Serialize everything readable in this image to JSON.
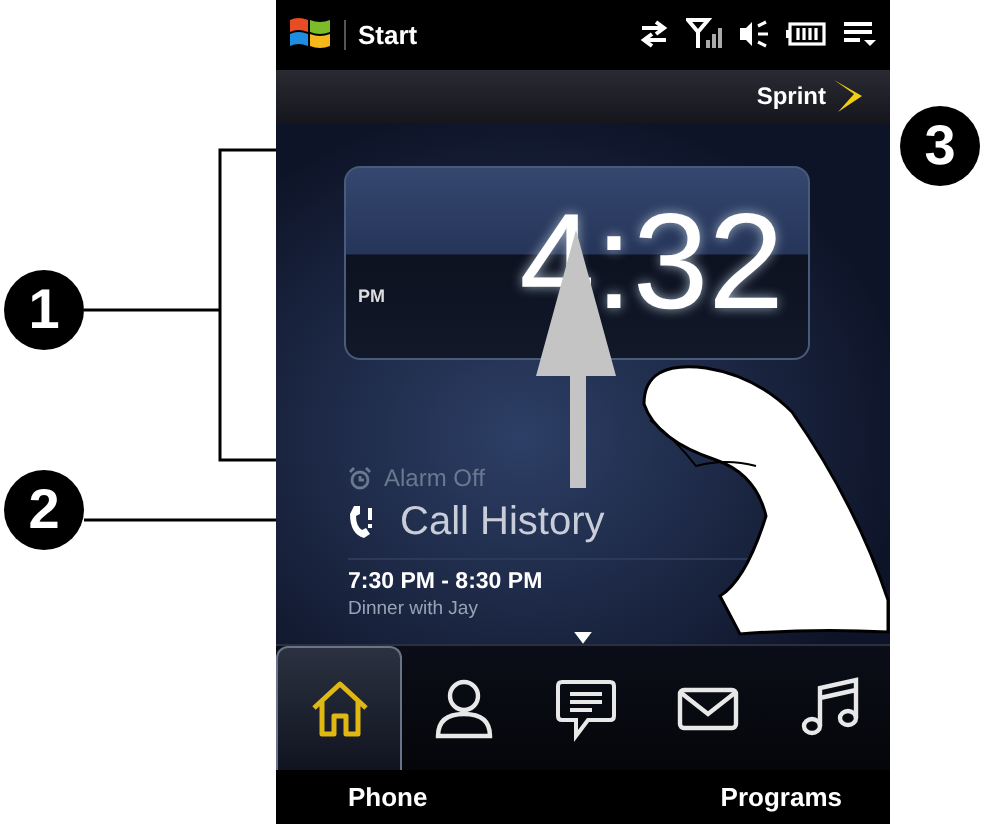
{
  "callouts": [
    {
      "number": "1"
    },
    {
      "number": "2"
    },
    {
      "number": "3"
    }
  ],
  "status_bar": {
    "title": "Start"
  },
  "carrier": "Sprint",
  "clock": {
    "time": "4:32",
    "period": "PM"
  },
  "alarm": {
    "label": "Alarm Off"
  },
  "call_history": {
    "label": "Call History"
  },
  "event": {
    "time": "7:30 PM - 8:30 PM",
    "title": "Dinner with Jay"
  },
  "tabs": [
    {
      "kind": "home",
      "selected": true
    },
    {
      "kind": "person",
      "selected": false
    },
    {
      "kind": "message",
      "selected": false
    },
    {
      "kind": "mail",
      "selected": false
    },
    {
      "kind": "music",
      "selected": false
    }
  ],
  "softkeys": [
    "Phone",
    "Programs"
  ]
}
